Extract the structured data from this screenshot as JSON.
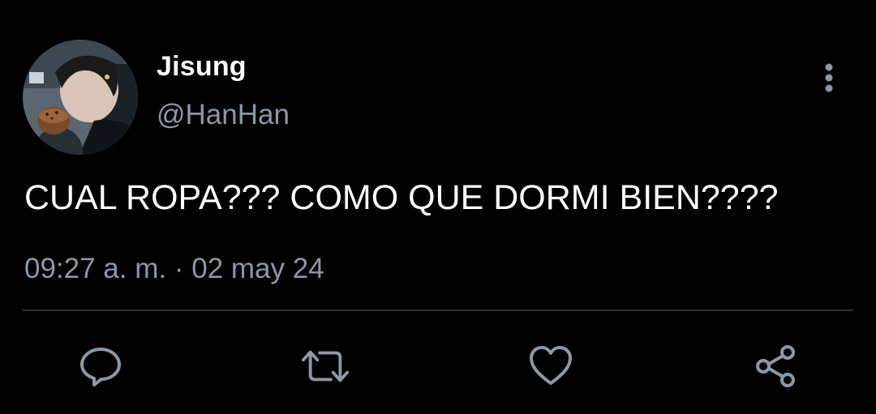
{
  "tweet": {
    "author": {
      "display_name": "Jisung",
      "handle": "@HanHan",
      "avatar_icon": "avatar-photo"
    },
    "text": "CUAL ROPA??? COMO QUE DORMI BIEN????",
    "time": "09:27 a. m.",
    "separator": "·",
    "date": "02 may 24",
    "more_icon": "vertical-ellipsis-icon"
  },
  "actions": [
    {
      "name": "reply",
      "icon": "speech-bubble-icon"
    },
    {
      "name": "retweet",
      "icon": "retweet-arrows-icon"
    },
    {
      "name": "like",
      "icon": "heart-icon"
    },
    {
      "name": "share",
      "icon": "share-nodes-icon"
    }
  ],
  "colors": {
    "background": "#000000",
    "primary_text": "#ffffff",
    "secondary_text": "#8b98a5",
    "divider": "#2f3336"
  }
}
